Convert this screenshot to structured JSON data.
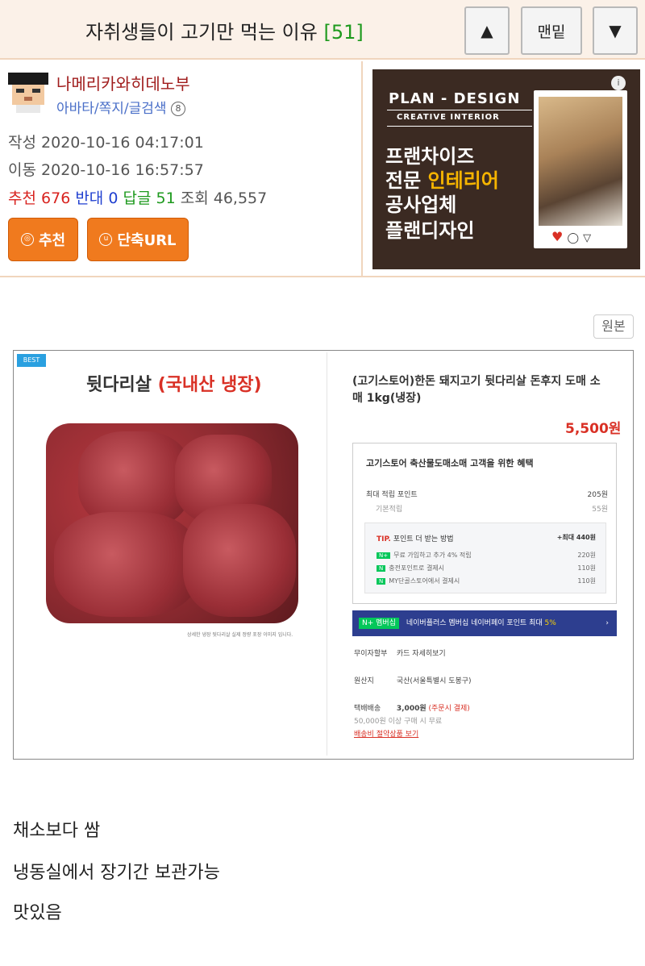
{
  "header": {
    "title": "자취생들이 고기만 먹는 이유",
    "comment_count": "[51]",
    "up_label": "▲",
    "bottom_label": "맨밑",
    "down_label": "▼"
  },
  "author": {
    "nickname": "나메리카와히데노부",
    "links": "아바타/쪽지/글검색",
    "badge": "8"
  },
  "meta": {
    "written_label": "작성",
    "written_time": "2020-10-16 04:17:01",
    "moved_label": "이동",
    "moved_time": "2020-10-16 16:57:57",
    "recommend_label": "추천",
    "recommend_count": "676",
    "oppose_label": "반대",
    "oppose_count": "0",
    "reply_label": "답글",
    "reply_count": "51",
    "views_label": "조회",
    "views_count": "46,557"
  },
  "buttons": {
    "recommend": "추천",
    "short_url": "단축URL"
  },
  "ad": {
    "title": "PLAN - DESIGN",
    "subtitle": "CREATIVE INTERIOR",
    "line1": "프랜차이즈",
    "line2_a": "전문 ",
    "line2_b": "인테리어",
    "line3": "공사업체",
    "line4": "플랜디자인",
    "actions": "♥ ◯ ▽"
  },
  "original_label": "원본",
  "product": {
    "best": "BEST",
    "title_a": "뒷다리살 ",
    "title_b": "(국내산 냉장)",
    "caption": "상세한 냉장 뒷다리살 실제 정량 포장 이미지 입니다.",
    "name": "(고기스토어)한돈 돼지고기 뒷다리살 돈후지 도매 소매 1kg(냉장)",
    "price": "5,500원",
    "benefit_title": "고기스토어 축산물도매소매 고객을 위한 혜택",
    "max_points_label": "최대 적립 포인트",
    "max_points": "205원",
    "basic_label": "기본적립",
    "basic_points": "55원",
    "tip_label": "TIP.",
    "tip_text": "포인트 더 받는 방법",
    "tip_max": "+최대 440원",
    "tip1": "무료 가입하고 추가 4% 적립",
    "tip1_val": "220원",
    "tip2": "충전포인트로 결제시",
    "tip2_val": "110원",
    "tip3": "MY단골스토어에서 결제시",
    "tip3_val": "110원",
    "bar_badge": "N+ 멤버십",
    "bar_text": "네이버플러스 멤버십 네이버페이 포인트 최대",
    "bar_pct": "5%",
    "installment_k": "무이자할부",
    "installment_v": "카드 자세히보기",
    "origin_k": "원산지",
    "origin_v": "국산(서울특별시 도봉구)",
    "ship_k": "택배배송",
    "ship_price": "3,000원",
    "ship_note": "(주문시 결제)",
    "ship_free": "50,000원 이상 구매 시 무료",
    "ship_link": "배송비 절약상품 보기"
  },
  "body": {
    "line1": "채소보다 쌈",
    "line2": "냉동실에서 장기간 보관가능",
    "line3": "맛있음"
  }
}
